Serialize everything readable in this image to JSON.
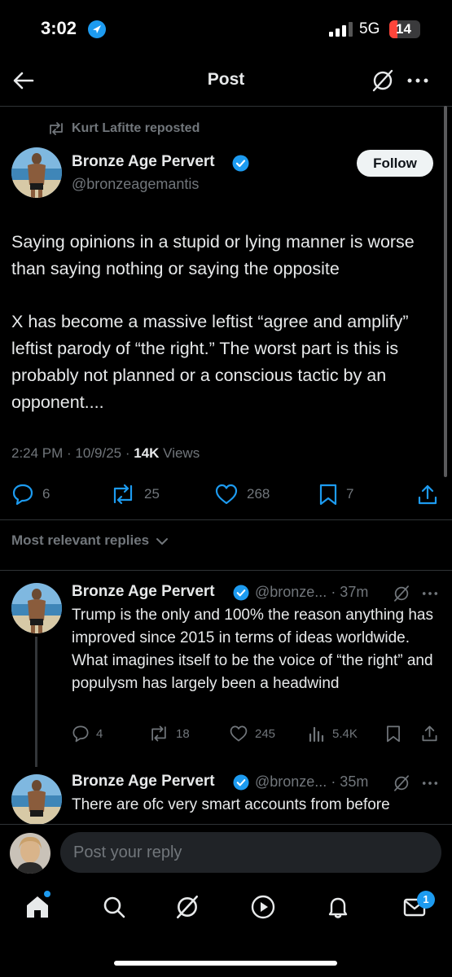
{
  "status_bar": {
    "time": "3:02",
    "network": "5G",
    "battery": "14"
  },
  "header": {
    "title": "Post",
    "grok_icon": "grok-icon",
    "more_icon": "more-icon"
  },
  "post": {
    "repost_text": "Kurt Lafitte reposted",
    "author_name": "Bronze Age Pervert",
    "handle": "@bronzeagemantis",
    "follow_label": "Follow",
    "paragraph1": "Saying opinions in a stupid or lying manner is worse than saying nothing or saying the opposite",
    "paragraph2": "X has become a massive leftist “agree and amplify” leftist parody of “the right.” The worst part is this is probably not planned or a conscious tactic by an opponent....",
    "time": "2:24 PM · 10/9/25 · ",
    "views_count": "14K",
    "views_label": " Views",
    "replies": "6",
    "reposts": "25",
    "likes": "268",
    "bookmarks": "7"
  },
  "sort_label": "Most relevant replies",
  "replies": [
    {
      "author_name": "Bronze Age Pervert",
      "handle_time": "@bronze... · 37m",
      "text": "Trump is the only and 100% the reason anything has improved since 2015 in terms of ideas worldwide. What imagines itself to be the voice of “the right” and populysm has largely been a headwind",
      "replies": "4",
      "reposts": "18",
      "likes": "245",
      "views": "5.4K"
    },
    {
      "author_name": "Bronze Age Pervert",
      "handle_time": "@bronze... · 35m",
      "text": "There are ofc very smart accounts from before"
    }
  ],
  "composer": {
    "placeholder": "Post your reply"
  },
  "tab_bar": {
    "messages_badge": "1"
  },
  "colors": {
    "accent": "#1d9bf0",
    "background": "#000000",
    "text": "#e7e9ea",
    "muted": "#71767b",
    "battery_low": "#ff453a"
  }
}
